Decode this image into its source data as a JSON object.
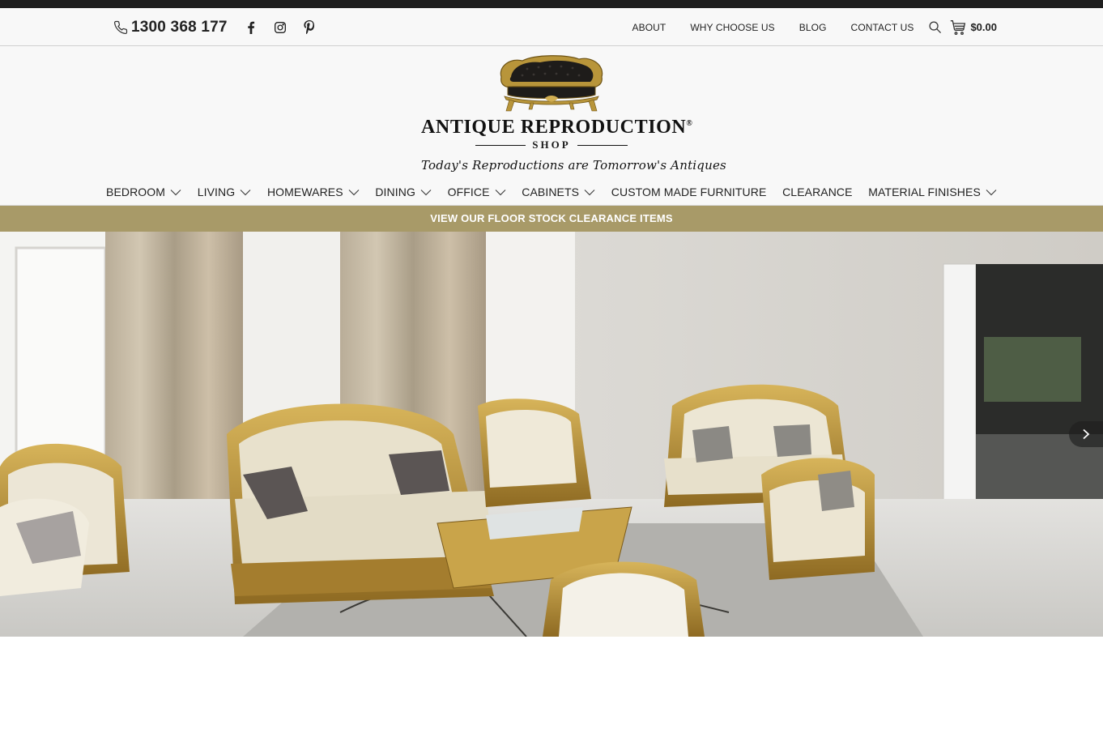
{
  "topbar": {
    "phone": "1300 368 177",
    "social": [
      "facebook-icon",
      "instagram-icon",
      "pinterest-icon"
    ],
    "links": [
      "ABOUT",
      "WHY CHOOSE US",
      "BLOG",
      "CONTACT US"
    ],
    "cart_total": "$0.00"
  },
  "logo": {
    "title": "ANTIQUE REPRODUCTION",
    "reg": "®",
    "subtitle": "SHOP",
    "tagline": "Today's Reproductions are Tomorrow's Antiques"
  },
  "nav": [
    {
      "label": "BEDROOM",
      "has_dropdown": true
    },
    {
      "label": "LIVING",
      "has_dropdown": true
    },
    {
      "label": "HOMEWARES",
      "has_dropdown": true
    },
    {
      "label": "DINING",
      "has_dropdown": true
    },
    {
      "label": "OFFICE",
      "has_dropdown": true
    },
    {
      "label": "CABINETS",
      "has_dropdown": true
    },
    {
      "label": "CUSTOM MADE FURNITURE",
      "has_dropdown": false
    },
    {
      "label": "CLEARANCE",
      "has_dropdown": false
    },
    {
      "label": "MATERIAL FINISHES",
      "has_dropdown": true
    }
  ],
  "promo": {
    "text": "VIEW OUR FLOOR STOCK CLEARANCE ITEMS"
  },
  "colors": {
    "accent": "#a89a68",
    "dark": "#1e1e1e",
    "gold": "#b8953a",
    "header_bg": "#f8f8f8"
  },
  "hero": {
    "icon_next": "chevron-right-icon"
  }
}
